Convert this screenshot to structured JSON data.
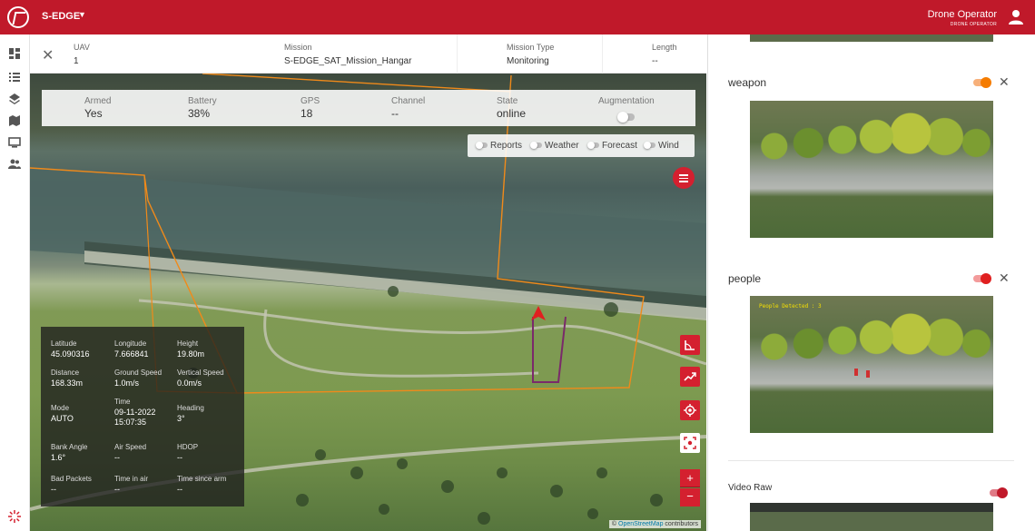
{
  "app": {
    "project": "S-EDGE",
    "user_role": "Drone Operator",
    "user_role_sub": "DRONE OPERATOR"
  },
  "mission_header": {
    "uav_label": "UAV",
    "uav_value": "1",
    "mission_label": "Mission",
    "mission_value": "S-EDGE_SAT_Mission_Hangar",
    "type_label": "Mission Type",
    "type_value": "Monitoring",
    "length_label": "Length",
    "length_value": "--"
  },
  "status": {
    "armed_label": "Armed",
    "armed_value": "Yes",
    "battery_label": "Battery",
    "battery_value": "38%",
    "gps_label": "GPS",
    "gps_value": "18",
    "channel_label": "Channel",
    "channel_value": "--",
    "state_label": "State",
    "state_value": "online",
    "augmentation_label": "Augmentation",
    "augmentation_on": false
  },
  "layers": {
    "reports": "Reports",
    "weather": "Weather",
    "forecast": "Forecast",
    "wind": "Wind"
  },
  "telemetry": {
    "latitude_label": "Latitude",
    "latitude_value": "45.090316",
    "longitude_label": "Longitude",
    "longitude_value": "7.666841",
    "height_label": "Height",
    "height_value": "19.80m",
    "distance_label": "Distance",
    "distance_value": "168.33m",
    "ground_speed_label": "Ground Speed",
    "ground_speed_value": "1.0m/s",
    "vertical_speed_label": "Vertical Speed",
    "vertical_speed_value": "0.0m/s",
    "mode_label": "Mode",
    "mode_value": "AUTO",
    "time_label": "Time",
    "time_date": "09-11-2022",
    "time_clock": "15:07:35",
    "heading_label": "Heading",
    "heading_value": "3°",
    "bank_angle_label": "Bank Angle",
    "bank_angle_value": "1.6°",
    "air_speed_label": "Air Speed",
    "air_speed_value": "--",
    "hdop_label": "HDOP",
    "hdop_value": "--",
    "bad_packets_label": "Bad Packets",
    "bad_packets_value": "--",
    "time_in_air_label": "Time in air",
    "time_in_air_value": "--",
    "time_since_arm_label": "Time since arm",
    "time_since_arm_value": "--"
  },
  "map": {
    "zoom_in": "+",
    "zoom_out": "−",
    "attribution_prefix": "©",
    "attribution_link": "OpenStreetMap",
    "attribution_suffix": "contributors"
  },
  "feeds": {
    "weapon_title": "weapon",
    "weapon_toggle_color": "#f57c00",
    "people_title": "people",
    "people_toggle_color": "#e02020",
    "people_detection_text": "People Detected : 3",
    "video_raw_title": "Video Raw",
    "video_raw_toggle_color": "#c0192a",
    "close_symbol": "✕"
  },
  "colors": {
    "brand": "#c0192a",
    "geofence": "#f08a1a",
    "route": "#7a2a6a"
  }
}
